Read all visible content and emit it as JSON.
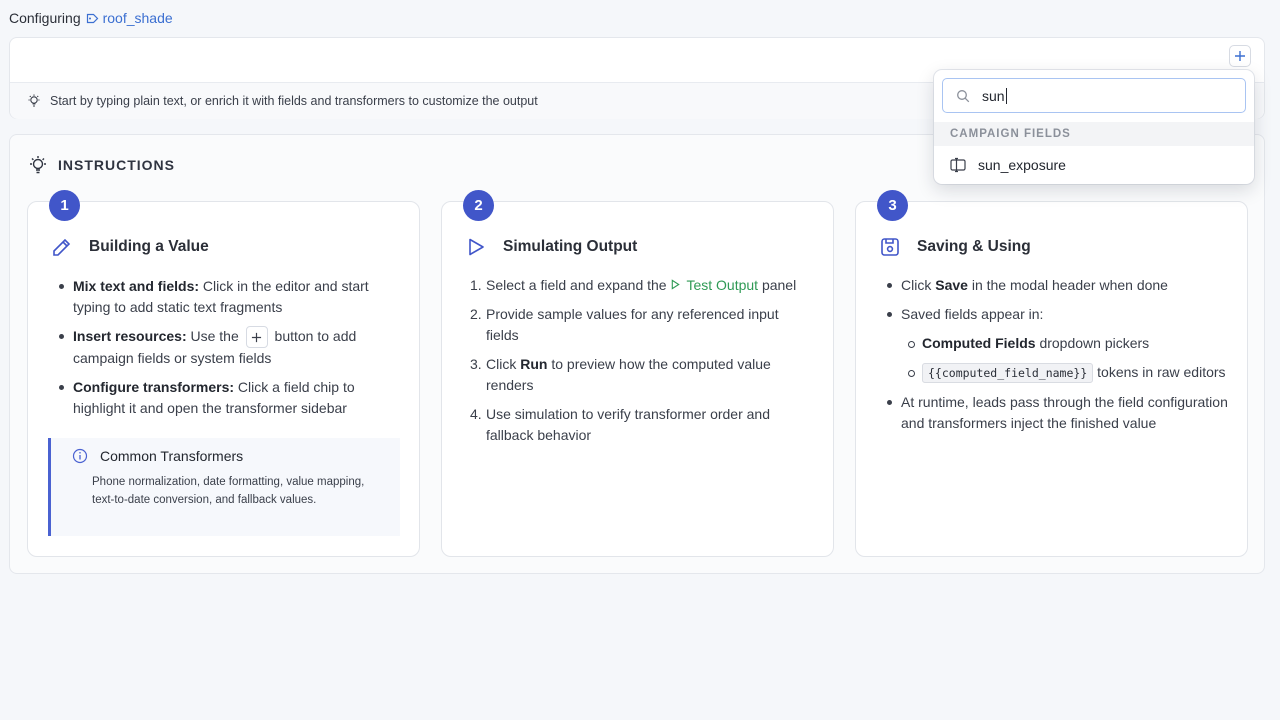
{
  "header": {
    "label": "Configuring",
    "resource_name": "roof_shade",
    "resource_icon": "tag-icon"
  },
  "editor": {
    "add_button_icon": "plus-icon",
    "hint_icon": "lightbulb-icon",
    "hint": "Start by typing plain text, or enrich it with fields and transformers to customize the output"
  },
  "instructions": {
    "title": "INSTRUCTIONS",
    "title_icon": "lightbulb-icon",
    "accent_color": "#4156c9",
    "steps": [
      {
        "number": "1",
        "title": "Building a Value",
        "icon": "pencil-icon",
        "items": [
          {
            "bold": "Mix text and fields:",
            "text": " Click in the editor and start typing to add static text fragments"
          },
          {
            "bold": "Insert resources:",
            "pre": " Use the ",
            "post": " button to add campaign fields or system fields"
          },
          {
            "bold": "Configure transformers:",
            "text": " Click a field chip to highlight it and open the transformer sidebar"
          }
        ],
        "callout": {
          "title": "Common Transformers",
          "icon": "info-icon",
          "body": "Phone normalization, date formatting, value mapping, text-to-date conversion, and fallback values."
        }
      },
      {
        "number": "2",
        "title": "Simulating Output",
        "icon": "play-icon",
        "items": [
          {
            "num": "1.",
            "pre": "Select a field and expand the ",
            "link": "Test Output",
            "post": " panel"
          },
          {
            "num": "2.",
            "text": "Provide sample values for any referenced input fields"
          },
          {
            "num": "3.",
            "pre": "Click ",
            "bold": "Run",
            "post": " to preview how the computed value renders"
          },
          {
            "num": "4.",
            "text": "Use simulation to verify transformer order and fallback behavior"
          }
        ]
      },
      {
        "number": "3",
        "title": "Saving & Using",
        "icon": "save-icon",
        "items": [
          {
            "pre": "Click ",
            "bold": "Save",
            "post": " in the modal header when done"
          },
          {
            "text": "Saved fields appear in:"
          },
          {
            "text": "At runtime, leads pass through the field configuration and transformers inject the finished value"
          }
        ],
        "sub_items": [
          {
            "bold": "Computed Fields",
            "post": " dropdown pickers"
          },
          {
            "code": "{{computed_field_name}}",
            "post": " tokens in raw editors"
          }
        ]
      }
    ]
  },
  "dropdown": {
    "search_value": "sun",
    "search_icon": "search-icon",
    "group_label": "CAMPAIGN FIELDS",
    "items": [
      {
        "label": "sun_exposure",
        "icon": "field-icon"
      }
    ]
  }
}
